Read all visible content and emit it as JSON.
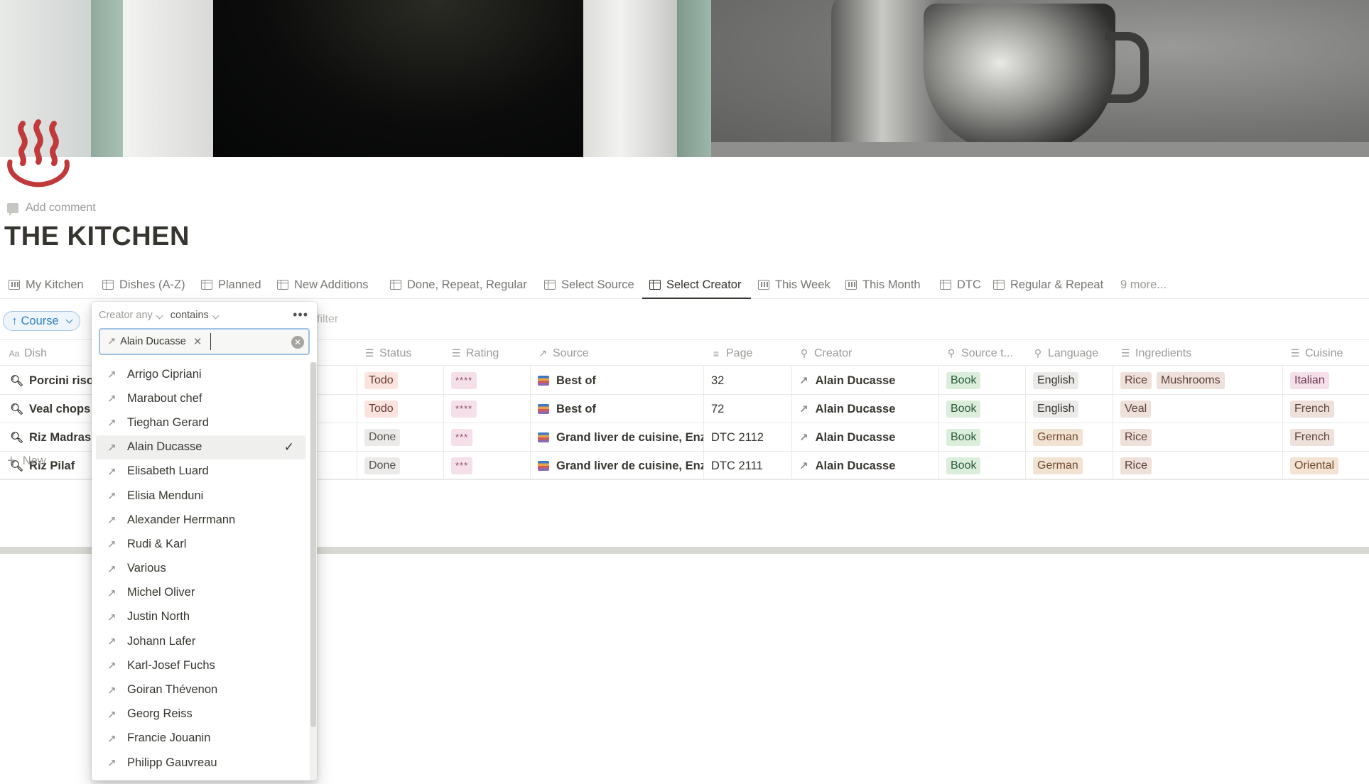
{
  "page": {
    "title": "THE KITCHEN",
    "add_comment": "Add comment"
  },
  "tabs": [
    {
      "label": "My Kitchen",
      "icon": "board-icon"
    },
    {
      "label": "Dishes (A-Z)",
      "icon": "table-icon"
    },
    {
      "label": "Planned",
      "icon": "table-icon"
    },
    {
      "label": "New Additions",
      "icon": "table-icon"
    },
    {
      "label": "Done, Repeat, Regular",
      "icon": "table-icon"
    },
    {
      "label": "Select Source",
      "icon": "table-icon"
    },
    {
      "label": "Select Creator",
      "icon": "table-icon",
      "active": true
    },
    {
      "label": "This Week",
      "icon": "board-icon"
    },
    {
      "label": "This Month",
      "icon": "board-icon"
    },
    {
      "label": "DTC",
      "icon": "table-icon"
    },
    {
      "label": "Regular & Repeat",
      "icon": "table-icon"
    }
  ],
  "more_tabs": "9 more...",
  "sort_pill": {
    "label": "Course",
    "arrow": "↑"
  },
  "add_filter": "filter",
  "columns": {
    "dish": "Dish",
    "status": "Status",
    "rating": "Rating",
    "source": "Source",
    "page": "Page",
    "creator": "Creator",
    "source_type": "Source t...",
    "language": "Language",
    "ingredients": "Ingredients",
    "cuisine": "Cuisine"
  },
  "rows": [
    {
      "dish": "Porcini risotto",
      "status": "Todo",
      "rating": "****",
      "source": "Best of",
      "page": "32",
      "creator": "Alain Ducasse",
      "source_type": "Book",
      "language": "English",
      "ingredients": [
        "Rice",
        "Mushrooms"
      ],
      "cuisine": "Italian"
    },
    {
      "dish": "Veal chops",
      "status": "Todo",
      "rating": "****",
      "source": "Best of",
      "page": "72",
      "creator": "Alain Ducasse",
      "source_type": "Book",
      "language": "English",
      "ingredients": [
        "Veal"
      ],
      "cuisine": "French"
    },
    {
      "dish": "Riz Madras",
      "status": "Done",
      "rating": "***",
      "source": "Grand liver de cuisine, Enz",
      "page": "DTC 2112",
      "creator": "Alain Ducasse",
      "source_type": "Book",
      "language": "German",
      "ingredients": [
        "Rice"
      ],
      "cuisine": "French"
    },
    {
      "dish": "Riz Pilaf",
      "status": "Done",
      "rating": "***",
      "source": "Grand liver de cuisine, Enz",
      "page": "DTC 2111",
      "creator": "Alain Ducasse",
      "source_type": "Book",
      "language": "German",
      "ingredients": [
        "Rice"
      ],
      "cuisine": "Oriental"
    }
  ],
  "new_row": "New",
  "filter_popup": {
    "property": "Creator any",
    "condition": "contains",
    "selected_chip": "Alain Ducasse",
    "options": [
      "Arrigo Cipriani",
      "Marabout chef",
      "Tieghan Gerard",
      "Alain Ducasse",
      "Elisabeth Luard",
      "Elisia Menduni",
      "Alexander Herrmann",
      "Rudi & Karl",
      "Various",
      "Michel Oliver",
      "Justin North",
      "Johann Lafer",
      "Karl-Josef Fuchs",
      "Goiran Thévenon",
      "Georg Reiss",
      "Francie Jouanin",
      "Philipp Gauvreau"
    ],
    "selected_option": "Alain Ducasse"
  }
}
